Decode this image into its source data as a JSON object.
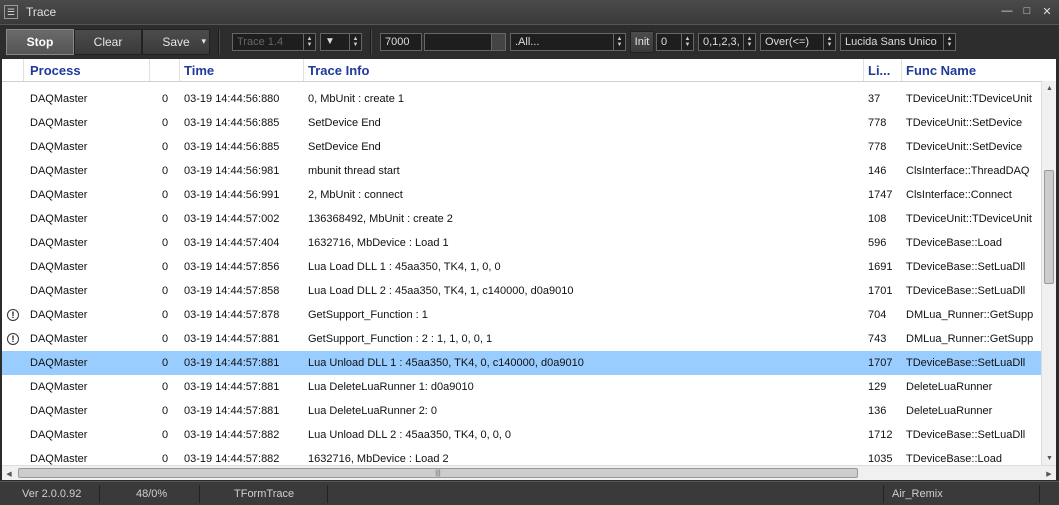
{
  "window": {
    "title": "Trace",
    "sysmenu_glyph": "☰",
    "minimize": "—",
    "maximize": "□",
    "close": "✕"
  },
  "toolbar": {
    "stop": "Stop",
    "clear": "Clear",
    "save": "Save",
    "save_arrow": "▾",
    "trace_combo": "Trace 1.4",
    "down_arrow": "▼",
    "count_value": "7000",
    "filter_value": ".All...",
    "init_label": "Init",
    "init_value": "0",
    "levels_value": "0,1,2,3,",
    "compare_value": "Over(<=)",
    "font_value": "Lucida Sans Unico"
  },
  "columns": {
    "process": "Process",
    "time": "Time",
    "trace_info": "Trace Info",
    "line": "Li...",
    "func_name": "Func Name"
  },
  "rows": [
    {
      "icon": "",
      "process": "DAQMaster",
      "num": "0",
      "time": "03-19 14:44:56:880",
      "info": "0, MbUnit : create 1",
      "line": "37",
      "func": "TDeviceUnit::TDeviceUnit"
    },
    {
      "icon": "",
      "process": "DAQMaster",
      "num": "0",
      "time": "03-19 14:44:56:885",
      "info": "SetDevice End",
      "line": "778",
      "func": "TDeviceUnit::SetDevice"
    },
    {
      "icon": "",
      "process": "DAQMaster",
      "num": "0",
      "time": "03-19 14:44:56:885",
      "info": "SetDevice End",
      "line": "778",
      "func": "TDeviceUnit::SetDevice"
    },
    {
      "icon": "",
      "process": "DAQMaster",
      "num": "0",
      "time": "03-19 14:44:56:981",
      "info": "mbunit thread start",
      "line": "146",
      "func": "ClsInterface::ThreadDAQ"
    },
    {
      "icon": "",
      "process": "DAQMaster",
      "num": "0",
      "time": "03-19 14:44:56:991",
      "info": "2, MbUnit : connect",
      "line": "1747",
      "func": "ClsInterface::Connect"
    },
    {
      "icon": "",
      "process": "DAQMaster",
      "num": "0",
      "time": "03-19 14:44:57:002",
      "info": "136368492, MbUnit : create 2",
      "line": "108",
      "func": "TDeviceUnit::TDeviceUnit"
    },
    {
      "icon": "",
      "process": "DAQMaster",
      "num": "0",
      "time": "03-19 14:44:57:404",
      "info": "1632716, MbDevice : Load 1",
      "line": "596",
      "func": "TDeviceBase::Load"
    },
    {
      "icon": "",
      "process": "DAQMaster",
      "num": "0",
      "time": "03-19 14:44:57:856",
      "info": "Lua Load DLL 1 : 45aa350, TK4, 1, 0, 0",
      "line": "1691",
      "func": "TDeviceBase::SetLuaDll"
    },
    {
      "icon": "",
      "process": "DAQMaster",
      "num": "0",
      "time": "03-19 14:44:57:858",
      "info": "Lua Load DLL 2 : 45aa350, TK4, 1, c140000, d0a9010",
      "line": "1701",
      "func": "TDeviceBase::SetLuaDll"
    },
    {
      "icon": "!",
      "process": "DAQMaster",
      "num": "0",
      "time": "03-19 14:44:57:878",
      "info": "GetSupport_Function : 1",
      "line": "704",
      "func": "DMLua_Runner::GetSupp"
    },
    {
      "icon": "!",
      "process": "DAQMaster",
      "num": "0",
      "time": "03-19 14:44:57:881",
      "info": "GetSupport_Function : 2 : 1, 1, 0, 0, 1",
      "line": "743",
      "func": "DMLua_Runner::GetSupp"
    },
    {
      "icon": "",
      "process": "DAQMaster",
      "num": "0",
      "time": "03-19 14:44:57:881",
      "info": "Lua Unload DLL 1 : 45aa350, TK4, 0, c140000, d0a9010",
      "line": "1707",
      "func": "TDeviceBase::SetLuaDll",
      "selected": true
    },
    {
      "icon": "",
      "process": "DAQMaster",
      "num": "0",
      "time": "03-19 14:44:57:881",
      "info": "Lua DeleteLuaRunner 1: d0a9010",
      "line": "129",
      "func": "DeleteLuaRunner"
    },
    {
      "icon": "",
      "process": "DAQMaster",
      "num": "0",
      "time": "03-19 14:44:57:881",
      "info": "Lua DeleteLuaRunner 2: 0",
      "line": "136",
      "func": "DeleteLuaRunner"
    },
    {
      "icon": "",
      "process": "DAQMaster",
      "num": "0",
      "time": "03-19 14:44:57:882",
      "info": "Lua Unload DLL 2 : 45aa350, TK4, 0, 0, 0",
      "line": "1712",
      "func": "TDeviceBase::SetLuaDll"
    },
    {
      "icon": "",
      "process": "DAQMaster",
      "num": "0",
      "time": "03-19 14:44:57:882",
      "info": "1632716, MbDevice : Load 2",
      "line": "1035",
      "func": "TDeviceBase::Load"
    }
  ],
  "scroll": {
    "up": "▲",
    "down": "▼",
    "left": "◀",
    "right": "▶",
    "grip": "|||"
  },
  "statusbar": {
    "version": "Ver 2.0.0.92",
    "ratio": "48/0%",
    "form": "TFormTrace",
    "skin": "Air_Remix"
  }
}
